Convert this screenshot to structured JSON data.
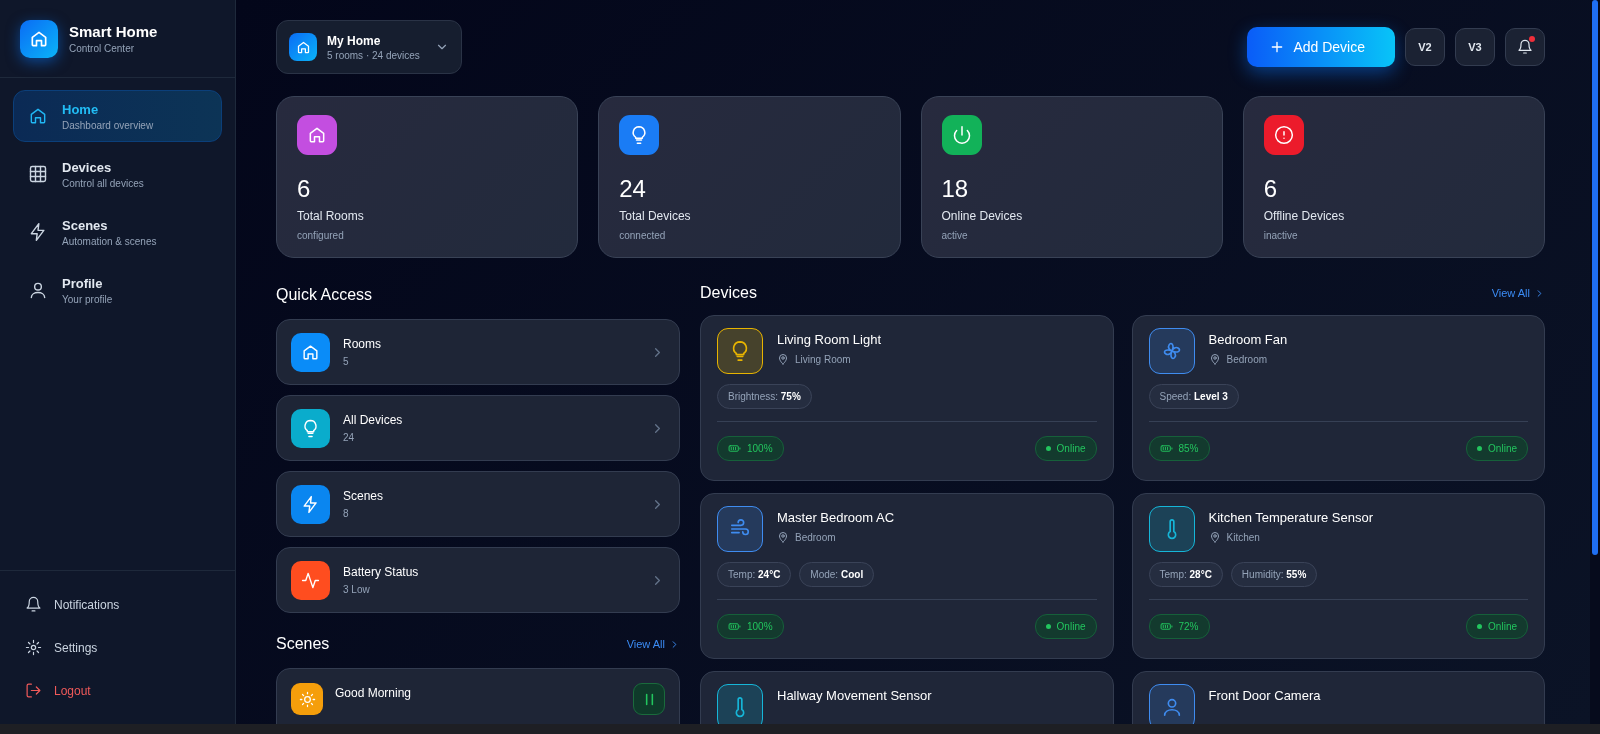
{
  "sidebar": {
    "brand": {
      "title": "Smart Home",
      "subtitle": "Control Center"
    },
    "nav": [
      {
        "label": "Home",
        "sublabel": "Dashboard overview",
        "selected": true
      },
      {
        "label": "Devices",
        "sublabel": "Control all devices",
        "selected": false
      },
      {
        "label": "Scenes",
        "sublabel": "Automation & scenes",
        "selected": false
      },
      {
        "label": "Profile",
        "sublabel": "Your profile",
        "selected": false
      }
    ],
    "footer": [
      {
        "label": "Notifications",
        "kind": "normal"
      },
      {
        "label": "Settings",
        "kind": "normal"
      },
      {
        "label": "Logout",
        "kind": "danger"
      }
    ]
  },
  "header": {
    "home": {
      "name": "My Home",
      "detail": "5 rooms · 24 devices"
    },
    "add_button": "Add Device",
    "version_buttons": [
      "V2",
      "V3"
    ],
    "notifications": {
      "unread": true
    }
  },
  "stats": [
    {
      "value": "6",
      "label": "Total Rooms",
      "note": "configured",
      "color": "#c34ee0"
    },
    {
      "value": "24",
      "label": "Total Devices",
      "note": "connected",
      "color": "#1a7cf5"
    },
    {
      "value": "18",
      "label": "Online Devices",
      "note": "active",
      "color": "#12b259"
    },
    {
      "value": "6",
      "label": "Offline Devices",
      "note": "inactive",
      "color": "#ec1b2b"
    }
  ],
  "quick_access": {
    "title": "Quick Access",
    "items": [
      {
        "label": "Rooms",
        "count": "5",
        "color": "#0a8cf8"
      },
      {
        "label": "All Devices",
        "count": "24",
        "color": "#0aaccc"
      },
      {
        "label": "Scenes",
        "count": "8",
        "color": "#0a86f0"
      },
      {
        "label": "Battery Status",
        "count": "3 Low",
        "color": "#ff4d1f"
      }
    ]
  },
  "scenes": {
    "title": "Scenes",
    "view_all": "View All",
    "items": [
      {
        "name": "Good Morning",
        "active": true
      }
    ]
  },
  "devices": {
    "title": "Devices",
    "view_all": "View All",
    "items": [
      {
        "name": "Living Room Light",
        "room": "Living Room",
        "color": "#e8b400",
        "props": [
          {
            "label": "Brightness:",
            "value": "75%"
          }
        ],
        "battery": "100%",
        "status": "Online",
        "online": true
      },
      {
        "name": "Bedroom Fan",
        "room": "Bedroom",
        "color": "#3f8cf0",
        "props": [
          {
            "label": "Speed:",
            "value": "Level 3"
          }
        ],
        "battery": "85%",
        "status": "Online",
        "online": true
      },
      {
        "name": "Master Bedroom AC",
        "room": "Bedroom",
        "color": "#3f8cf0",
        "props": [
          {
            "label": "Temp:",
            "value": "24°C"
          },
          {
            "label": "Mode:",
            "value": "Cool"
          }
        ],
        "battery": "100%",
        "status": "Online",
        "online": true
      },
      {
        "name": "Kitchen Temperature Sensor",
        "room": "Kitchen",
        "color": "#16b6d8",
        "props": [
          {
            "label": "Temp:",
            "value": "28°C"
          },
          {
            "label": "Humidity:",
            "value": "55%"
          }
        ],
        "battery": "72%",
        "status": "Online",
        "online": true
      },
      {
        "name": "Hallway Movement Sensor",
        "color": "#16b6d8"
      },
      {
        "name": "Front Door Camera",
        "color": "#3f8cf0"
      }
    ]
  }
}
